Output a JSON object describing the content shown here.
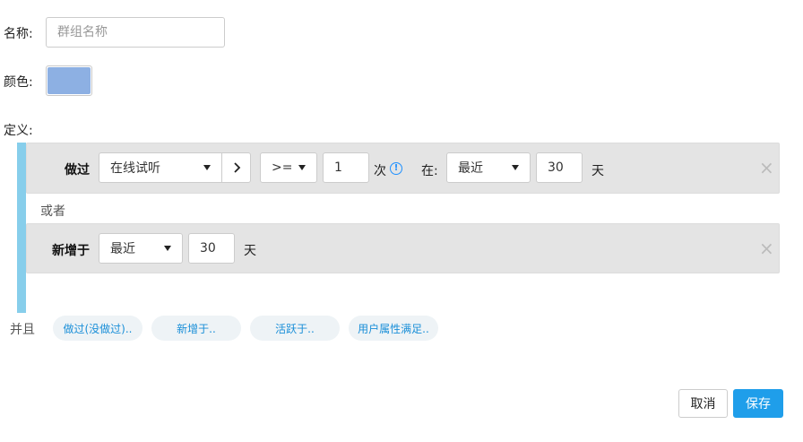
{
  "form": {
    "name_label": "名称:",
    "name_placeholder": "群组名称",
    "color_label": "颜色:",
    "color_value": "#8db0e3",
    "definition_label": "定义:"
  },
  "conditions": {
    "row1": {
      "verb": "做过",
      "event_select": "在线试听",
      "operator_select": ">=",
      "count_value": "1",
      "count_unit": "次",
      "at_label": "在:",
      "time_select": "最近",
      "days_value": "30",
      "days_unit": "天"
    },
    "or_label": "或者",
    "row2": {
      "verb": "新增于",
      "time_select": "最近",
      "days_value": "30",
      "days_unit": "天"
    }
  },
  "and_section": {
    "label": "并且",
    "chips": [
      "做过(没做过)..",
      "新增于..",
      "活跃于..",
      "用户属性满足.."
    ]
  },
  "actions": {
    "cancel_label": "取消",
    "save_label": "保存"
  },
  "colors": {
    "accent_bar": "#87ceeb",
    "primary_button": "#1f9eea",
    "chip_text": "#1a8fd8"
  }
}
